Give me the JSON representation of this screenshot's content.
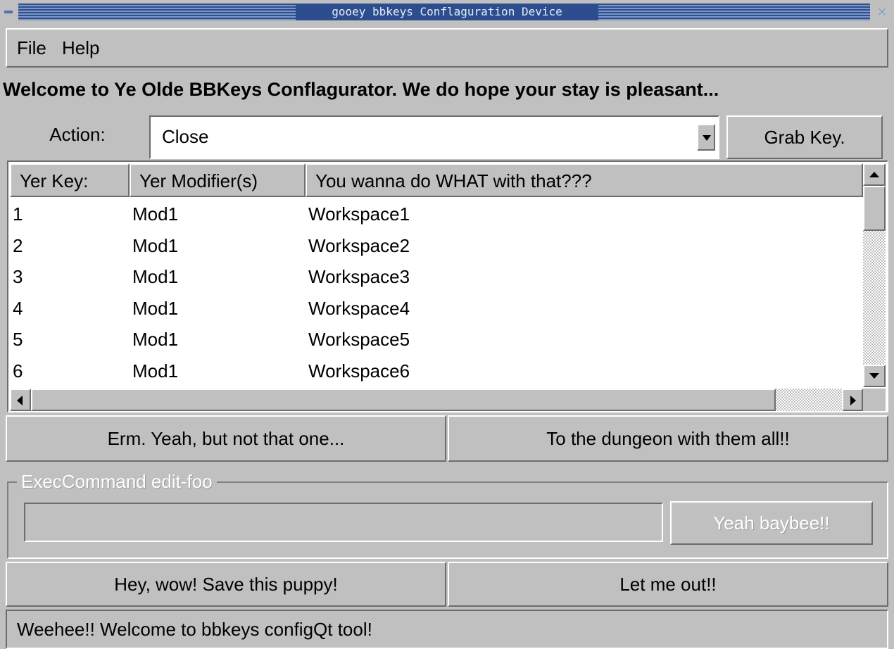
{
  "window": {
    "title": "gooey bbkeys Conflaguration Device",
    "close_glyph": "×"
  },
  "menubar": {
    "items": [
      {
        "label": "File"
      },
      {
        "label": "Help"
      }
    ]
  },
  "welcome": "Welcome to Ye Olde BBKeys Conflagurator. We do hope your stay is pleasant...",
  "action": {
    "label": "Action:",
    "value": "Close",
    "grab_label": "Grab Key."
  },
  "list": {
    "columns": [
      "Yer Key:",
      "Yer Modifier(s)",
      "You wanna do WHAT with that???"
    ],
    "rows": [
      {
        "key": "1",
        "modifier": "Mod1",
        "action": "Workspace1"
      },
      {
        "key": "2",
        "modifier": "Mod1",
        "action": "Workspace2"
      },
      {
        "key": "3",
        "modifier": "Mod1",
        "action": "Workspace3"
      },
      {
        "key": "4",
        "modifier": "Mod1",
        "action": "Workspace4"
      },
      {
        "key": "5",
        "modifier": "Mod1",
        "action": "Workspace5"
      },
      {
        "key": "6",
        "modifier": "Mod1",
        "action": "Workspace6"
      }
    ]
  },
  "list_buttons": {
    "remove": "Erm. Yeah, but not that one...",
    "remove_all": "To the dungeon with them all!!"
  },
  "exec": {
    "legend": "ExecCommand edit-foo",
    "input_value": "",
    "apply_label": "Yeah baybee!!"
  },
  "bottom_buttons": {
    "save": "Hey, wow! Save this puppy!",
    "exit": "Let me out!!"
  },
  "status": "Weehee!!  Welcome to bbkeys configQt tool!",
  "colors": {
    "face": "#c0c0c0",
    "titlebar": "#2c4e8e",
    "disabled_text": "#ffffff"
  }
}
